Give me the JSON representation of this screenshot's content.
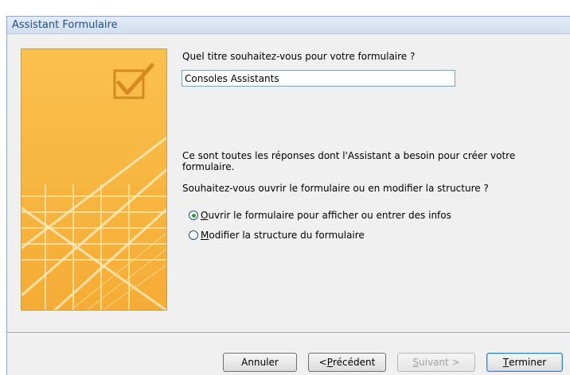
{
  "window": {
    "title": "Assistant Formulaire"
  },
  "form": {
    "question": "Quel titre souhaitez-vous pour votre formulaire ?",
    "title_value": "Consoles Assistants",
    "info_text": "Ce sont toutes les réponses dont l'Assistant a besoin pour créer votre formulaire.",
    "question2": "Souhaitez-vous ouvrir le formulaire ou en modifier la structure ?",
    "options": [
      {
        "mnemonic": "O",
        "rest": "uvrir le formulaire pour afficher ou entrer des infos",
        "checked": true
      },
      {
        "mnemonic": "M",
        "rest": "odifier la structure du formulaire",
        "checked": false
      }
    ]
  },
  "buttons": {
    "cancel": {
      "label": "Annuler"
    },
    "previous": {
      "prefix": "< ",
      "mnemonic": "P",
      "rest": "récédent"
    },
    "next": {
      "mnemonic": "S",
      "rest": "uivant >",
      "enabled": false
    },
    "finish": {
      "mnemonic": "T",
      "rest": "erminer"
    }
  },
  "colors": {
    "accent_title": "#1f4e86",
    "banner": "#f8b84a",
    "radio_dot": "#2e9d3c"
  }
}
